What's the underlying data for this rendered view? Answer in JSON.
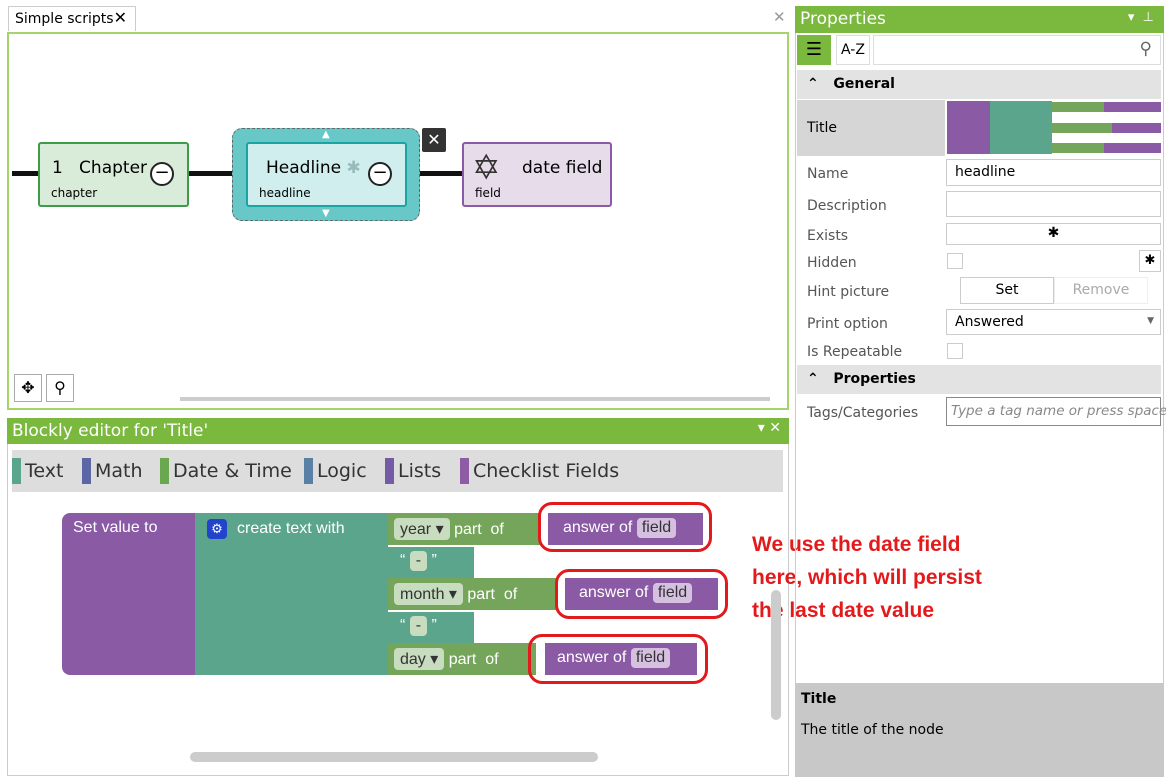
{
  "document_tab": {
    "label": "Simple scripts",
    "close": "✕"
  },
  "canvas": {
    "nodes": [
      {
        "number": "1",
        "title": "Chapter",
        "type": "chapter"
      },
      {
        "title": "Headline",
        "type": "headline"
      },
      {
        "title": "date field",
        "type": "field"
      }
    ],
    "delete": "✕"
  },
  "blockly": {
    "title": "Blockly editor for 'Title'",
    "categories": [
      {
        "label": "Text",
        "color": "#5ba58c"
      },
      {
        "label": "Math",
        "color": "#5b67a5"
      },
      {
        "label": "Date & Time",
        "color": "#6aa84f"
      },
      {
        "label": "Logic",
        "color": "#5b80a5"
      },
      {
        "label": "Lists",
        "color": "#745ba5"
      },
      {
        "label": "Checklist Fields",
        "color": "#8e5ba5"
      }
    ],
    "set_value": "Set value to",
    "create_text": "create text with",
    "rows": [
      {
        "part": "year",
        "part_of": "part  of",
        "answer": "answer of",
        "field": "field"
      },
      {
        "part": "month",
        "part_of": "part  of",
        "answer": "answer of",
        "field": "field"
      },
      {
        "part": "day",
        "part_of": "part  of",
        "answer": "answer of",
        "field": "field"
      }
    ],
    "separator": "-",
    "annotation": [
      "We use the date field",
      "here, which will persist",
      "the last date value"
    ]
  },
  "properties": {
    "title": "Properties",
    "az": "A-Z",
    "general": "General",
    "rows": {
      "title": "Title",
      "name": "Name",
      "name_value": "headline",
      "description": "Description",
      "exists": "Exists",
      "hidden": "Hidden",
      "hint": "Hint picture",
      "set": "Set",
      "remove": "Remove",
      "print": "Print option",
      "print_value": "Answered",
      "repeatable": "Is Repeatable"
    },
    "properties_section": "Properties",
    "tags": "Tags/Categories",
    "tags_placeholder": "Type a tag name or press space.",
    "help_title": "Title",
    "help_text": "The title of the node"
  }
}
